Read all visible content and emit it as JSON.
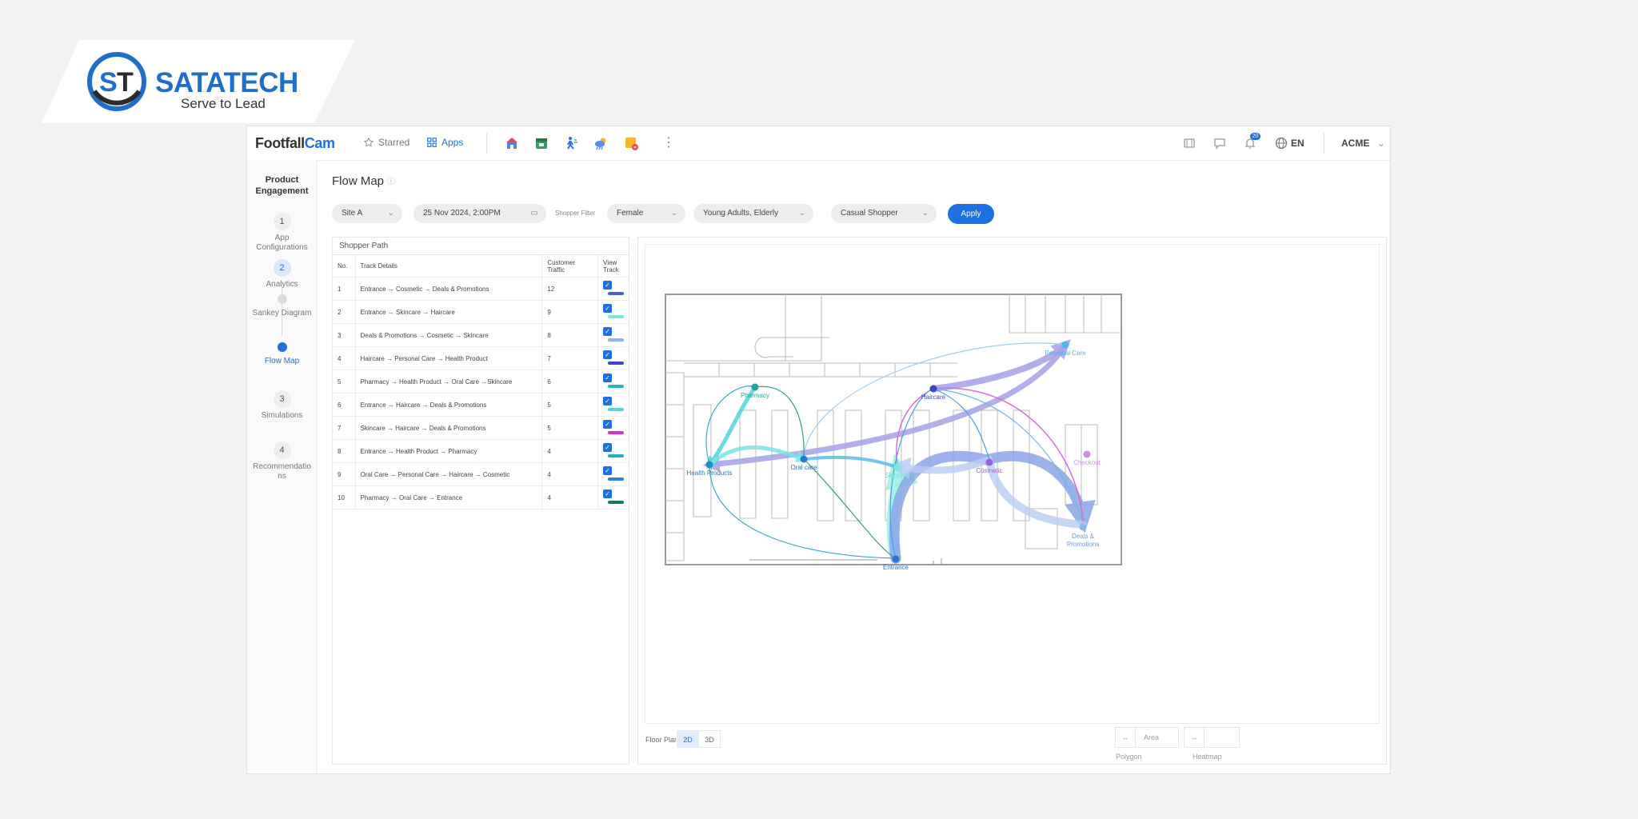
{
  "brand": {
    "name": "SATATECH",
    "tagline": "Serve to Lead",
    "accent": "#1f6ec9"
  },
  "topbar": {
    "logo_main": "Footfall",
    "logo_cam": "Cam",
    "starred_label": "Starred",
    "apps_label": "Apps",
    "notification_count": "20",
    "language": "EN",
    "user": "ACME"
  },
  "sidebar": {
    "title": "Product Engagement",
    "steps": [
      {
        "num": "1",
        "label": "App Configurations"
      },
      {
        "num": "2",
        "label": "Analytics"
      },
      {
        "sub": "Sankey Diagram"
      },
      {
        "sub": "Flow Map"
      },
      {
        "num": "3",
        "label": "Simulations"
      },
      {
        "num": "4",
        "label": "Recommendations"
      }
    ]
  },
  "page": {
    "title": "Flow Map"
  },
  "filters": {
    "site": "Site A",
    "datetime": "25 Nov 2024, 2:00PM",
    "shopper_filter_label": "Shopper Filter",
    "gender": "Female",
    "age": "Young Adults, Elderly",
    "type": "Casual Shopper",
    "apply": "Apply"
  },
  "table": {
    "title": "Shopper Path",
    "headers": [
      "No.",
      "Track Details",
      "Customer Traffic",
      "View Track"
    ],
    "rows": [
      {
        "no": "1",
        "track": "Entrance → Cosmetic → Deals & Promotions",
        "traffic": "12",
        "color": "#4a5fd6"
      },
      {
        "no": "2",
        "track": "Entrance → Skincare → Haircare",
        "traffic": "9",
        "color": "#7ee6df"
      },
      {
        "no": "3",
        "track": "Deals & Promotions → Cosmetic → Skincare",
        "traffic": "8",
        "color": "#8fb3ef"
      },
      {
        "no": "4",
        "track": "Haircare → Personal Care → Health Product",
        "traffic": "7",
        "color": "#3f44c4"
      },
      {
        "no": "5",
        "track": "Pharmacy → Health Product → Oral Care →Skincare",
        "traffic": "6",
        "color": "#27b6c9"
      },
      {
        "no": "6",
        "track": "Entrance → Haircare → Deals & Promotions",
        "traffic": "5",
        "color": "#4fd3e0"
      },
      {
        "no": "7",
        "track": "Skincare → Haircare → Deals & Promotions",
        "traffic": "5",
        "color": "#d62fd8"
      },
      {
        "no": "8",
        "track": "Entrance → Health Product → Pharmacy",
        "traffic": "4",
        "color": "#2aa8c8"
      },
      {
        "no": "9",
        "track": "Oral Care → Personal Care → Haircare → Cosmetic",
        "traffic": "4",
        "color": "#2f7fe0"
      },
      {
        "no": "10",
        "track": "Pharmacy → Oral Care → Entrance",
        "traffic": "4",
        "color": "#167a52"
      }
    ]
  },
  "map": {
    "nodes": {
      "pharmacy": "Pharmacy",
      "health": "Health Products",
      "oral": "Oral care",
      "skincare": "Skincare",
      "haircare": "Haircare",
      "personal": "Personal Care",
      "cosmetic": "Cosmetic",
      "checkout": "Checkout",
      "deals_1": "Deals &",
      "deals_2": "Promotions",
      "entrance": "Entrance"
    },
    "floor_plan_label": "Floor Plan",
    "view_2d": "2D",
    "view_3d": "3D",
    "area_polygon": "Area Polygon",
    "heatmap": "Heatmap"
  }
}
